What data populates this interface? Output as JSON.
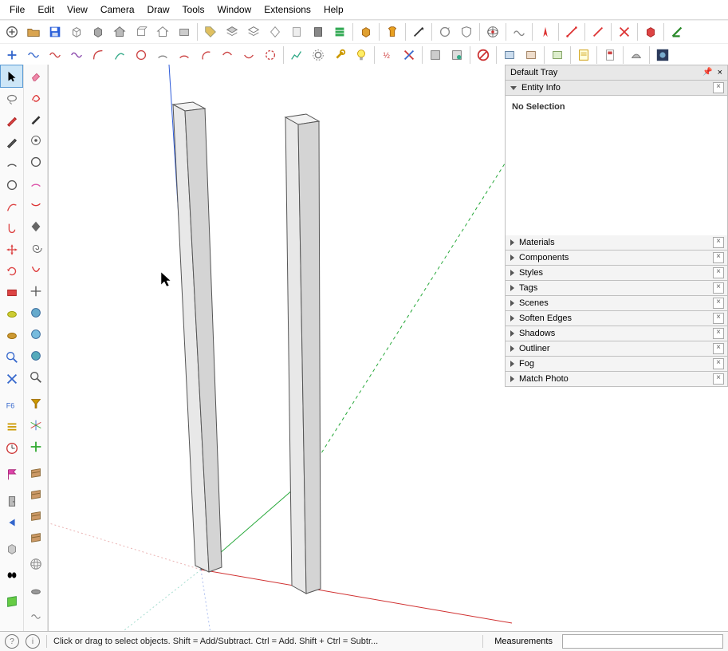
{
  "menu": [
    "File",
    "Edit",
    "View",
    "Camera",
    "Draw",
    "Tools",
    "Window",
    "Extensions",
    "Help"
  ],
  "toolbar_row1": [
    {
      "n": "add-detail-icon",
      "svg": "circle-plus"
    },
    {
      "n": "open-icon",
      "svg": "folder"
    },
    {
      "n": "save-icon",
      "svg": "disk"
    },
    {
      "n": "box-icon",
      "svg": "cube-wire"
    },
    {
      "n": "box2-icon",
      "svg": "cube-solid"
    },
    {
      "n": "house-icon",
      "svg": "house"
    },
    {
      "n": "box3-icon",
      "svg": "cube-open"
    },
    {
      "n": "house2-icon",
      "svg": "house-wire"
    },
    {
      "n": "box4-icon",
      "svg": "cube-flat"
    },
    {
      "sep": true
    },
    {
      "n": "tag-icon",
      "svg": "tag"
    },
    {
      "n": "layers-icon",
      "svg": "layers"
    },
    {
      "n": "layers2-icon",
      "svg": "layers-wire"
    },
    {
      "n": "diamond-icon",
      "svg": "diamond"
    },
    {
      "n": "sheet-icon",
      "svg": "sheet"
    },
    {
      "n": "sheet2-icon",
      "svg": "sheet-dark"
    },
    {
      "n": "stripes-icon",
      "svg": "stripes"
    },
    {
      "sep": true
    },
    {
      "n": "warehouse-icon",
      "svg": "box-gold"
    },
    {
      "sep": true
    },
    {
      "n": "tshirt-icon",
      "svg": "tshirt"
    },
    {
      "sep": true
    },
    {
      "n": "quill-icon",
      "svg": "quill"
    },
    {
      "sep": true
    },
    {
      "n": "loop1-icon",
      "svg": "loop"
    },
    {
      "n": "shield-icon",
      "svg": "shield"
    },
    {
      "sep": true
    },
    {
      "n": "globe-icon",
      "svg": "globe"
    },
    {
      "sep": true
    },
    {
      "n": "wave-icon",
      "svg": "wave"
    },
    {
      "sep": true
    },
    {
      "n": "compass-icon",
      "svg": "compass-red"
    },
    {
      "sep": true
    },
    {
      "n": "line-red-icon",
      "svg": "line-red"
    },
    {
      "sep": true
    },
    {
      "n": "line-red2-icon",
      "svg": "line-red2"
    },
    {
      "sep": true
    },
    {
      "n": "x-red-icon",
      "svg": "x-red"
    },
    {
      "sep": true
    },
    {
      "n": "cube-red-icon",
      "svg": "cube-red"
    },
    {
      "sep": true
    },
    {
      "n": "angle-green-icon",
      "svg": "angle-green"
    }
  ],
  "toolbar_row2": [
    {
      "n": "plus-icon",
      "svg": "plus-blue"
    },
    {
      "n": "wave1-icon",
      "svg": "wave-blue"
    },
    {
      "n": "wave2-icon",
      "svg": "wave-red"
    },
    {
      "n": "wave3-icon",
      "svg": "wave-purple"
    },
    {
      "n": "curve1-icon",
      "svg": "curve1"
    },
    {
      "n": "curve2-icon",
      "svg": "curve2"
    },
    {
      "n": "circle-icon",
      "svg": "circle-outline"
    },
    {
      "n": "arc1-icon",
      "svg": "arc1"
    },
    {
      "n": "arc2-icon",
      "svg": "arc2"
    },
    {
      "n": "arc3-icon",
      "svg": "arc3"
    },
    {
      "n": "arc4-icon",
      "svg": "arc4"
    },
    {
      "n": "arc5-icon",
      "svg": "arc5"
    },
    {
      "n": "arc6-icon",
      "svg": "arc6"
    },
    {
      "sep": true
    },
    {
      "n": "graph-icon",
      "svg": "graph"
    },
    {
      "n": "gear-icon",
      "svg": "gear"
    },
    {
      "n": "wrench-icon",
      "svg": "wrench"
    },
    {
      "n": "bulb-icon",
      "svg": "bulb"
    },
    {
      "sep": true
    },
    {
      "n": "z-icon",
      "svg": "zfrac"
    },
    {
      "n": "zx-icon",
      "svg": "zx"
    },
    {
      "sep": true
    },
    {
      "n": "ext1-icon",
      "svg": "ext1"
    },
    {
      "n": "ext2-icon",
      "svg": "ext2"
    },
    {
      "sep": true
    },
    {
      "n": "noentry-icon",
      "svg": "noentry"
    },
    {
      "sep": true
    },
    {
      "n": "ext3-icon",
      "svg": "ext3"
    },
    {
      "n": "ext4-icon",
      "svg": "ext4"
    },
    {
      "sep": true
    },
    {
      "n": "ext5-icon",
      "svg": "ext5"
    },
    {
      "sep": true
    },
    {
      "n": "note-icon",
      "svg": "note"
    },
    {
      "sep": true
    },
    {
      "n": "page-icon",
      "svg": "page"
    },
    {
      "sep": true
    },
    {
      "n": "surf-icon",
      "svg": "surf"
    },
    {
      "sep": true
    },
    {
      "n": "dark-icon",
      "svg": "dark",
      "bg": "#2b3a5c"
    }
  ],
  "left_col1": [
    {
      "n": "select-tool-icon",
      "svg": "cursor",
      "sel": true
    },
    {
      "n": "tool-lasso-icon",
      "svg": "lasso"
    },
    {
      "n": "tool-pencil-icon",
      "svg": "pencil-red"
    },
    {
      "n": "tool-pencil2-icon",
      "svg": "pencil"
    },
    {
      "n": "tool-arc-icon",
      "svg": "arc-dark"
    },
    {
      "n": "tool-circ-icon",
      "svg": "circle-dark"
    },
    {
      "n": "tool-curve-icon",
      "svg": "curve-red"
    },
    {
      "n": "tool-hook-icon",
      "svg": "hook-red"
    },
    {
      "n": "tool-move-icon",
      "svg": "move-red"
    },
    {
      "n": "tool-rotate-icon",
      "svg": "rotate-red"
    },
    {
      "n": "tool-rect-icon",
      "svg": "rect-red"
    },
    {
      "n": "tool-blob-icon",
      "svg": "blob"
    },
    {
      "n": "tool-blob2-icon",
      "svg": "blob2"
    },
    {
      "n": "tool-zoom-icon",
      "svg": "zoom-blue"
    },
    {
      "n": "tool-cross-icon",
      "svg": "cross-blue"
    },
    {
      "n": "spacer",
      "svg": ""
    },
    {
      "n": "tool-f6-icon",
      "svg": "f6"
    },
    {
      "n": "tool-lines-icon",
      "svg": "lines-gold"
    },
    {
      "n": "tool-clock-icon",
      "svg": "clock"
    },
    {
      "n": "spacer",
      "svg": ""
    },
    {
      "n": "tool-flag-icon",
      "svg": "flag-pink"
    },
    {
      "n": "spacer",
      "svg": ""
    },
    {
      "n": "tool-door-icon",
      "svg": "door"
    },
    {
      "n": "tool-arrow-icon",
      "svg": "arrow-left"
    },
    {
      "n": "spacer",
      "svg": ""
    },
    {
      "n": "tool-cube-icon",
      "svg": "cube-grey"
    },
    {
      "n": "spacer",
      "svg": ""
    },
    {
      "n": "tool-blackdots-icon",
      "svg": "blackdots"
    },
    {
      "n": "spacer",
      "svg": ""
    },
    {
      "n": "tool-greensheet-icon",
      "svg": "greensheet"
    }
  ],
  "left_col2": [
    {
      "n": "eraser-icon",
      "svg": "eraser-pink"
    },
    {
      "n": "tool-swirl-icon",
      "svg": "swirl-red"
    },
    {
      "n": "tool-pencil3-icon",
      "svg": "pencil-solid"
    },
    {
      "n": "tool-target-icon",
      "svg": "target"
    },
    {
      "n": "tool-circ2-icon",
      "svg": "circle-dark"
    },
    {
      "n": "tool-arc2-icon",
      "svg": "arc-pink"
    },
    {
      "n": "tool-arc3-icon",
      "svg": "arc-red2"
    },
    {
      "n": "tool-diamond-icon",
      "svg": "diamond-dark"
    },
    {
      "n": "tool-spiral-icon",
      "svg": "spiral"
    },
    {
      "n": "tool-swirl2-icon",
      "svg": "swirl-red2"
    },
    {
      "n": "tool-arrows-icon",
      "svg": "arrows-dark"
    },
    {
      "n": "tool-globe-icon",
      "svg": "globe-sm"
    },
    {
      "n": "tool-globe2-icon",
      "svg": "globe-sm2"
    },
    {
      "n": "tool-globe3-icon",
      "svg": "globe-sm3"
    },
    {
      "n": "tool-zoom2-icon",
      "svg": "zoom-dark"
    },
    {
      "n": "spacer",
      "svg": ""
    },
    {
      "n": "tool-funnel-icon",
      "svg": "funnel"
    },
    {
      "n": "tool-axes-icon",
      "svg": "axes"
    },
    {
      "n": "tool-axes2-icon",
      "svg": "axes-green"
    },
    {
      "n": "spacer",
      "svg": ""
    },
    {
      "n": "tool-wood1-icon",
      "svg": "wood"
    },
    {
      "n": "tool-wood2-icon",
      "svg": "wood"
    },
    {
      "n": "tool-wood3-icon",
      "svg": "wood"
    },
    {
      "n": "tool-wood4-icon",
      "svg": "wood"
    },
    {
      "n": "spacer",
      "svg": ""
    },
    {
      "n": "tool-sphere-icon",
      "svg": "sphere-wire"
    },
    {
      "n": "spacer",
      "svg": ""
    },
    {
      "n": "tool-cap-icon",
      "svg": "cap"
    },
    {
      "n": "spacer",
      "svg": ""
    },
    {
      "n": "tool-squiggle-icon",
      "svg": "squiggle"
    }
  ],
  "tray": {
    "title": "Default Tray",
    "expanded_panel": "Entity Info",
    "entity_body": "No Selection",
    "panels": [
      "Materials",
      "Components",
      "Styles",
      "Tags",
      "Scenes",
      "Soften Edges",
      "Shadows",
      "Outliner",
      "Fog",
      "Match Photo"
    ]
  },
  "status": {
    "hint": "Click or drag to select objects. Shift = Add/Subtract. Ctrl = Add. Shift + Ctrl = Subtr...",
    "meas_label": "Measurements",
    "meas_value": ""
  }
}
